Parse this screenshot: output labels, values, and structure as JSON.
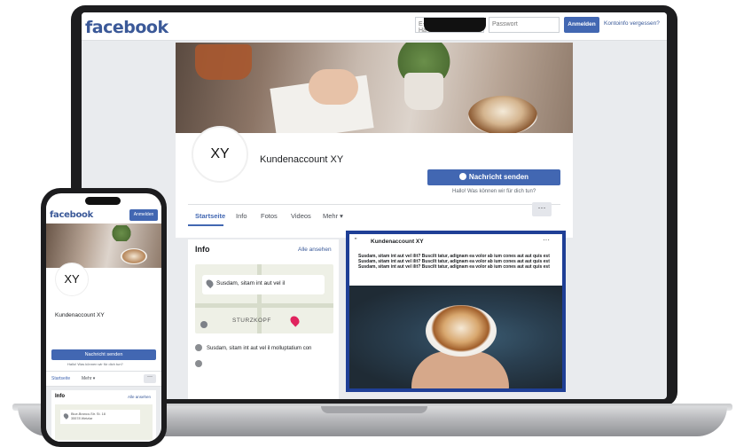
{
  "desktop": {
    "logo": "facebook",
    "login": {
      "email_placeholder": "E-Mail-Adresse oder Ha",
      "password_placeholder": "Passwort",
      "button_label": "Anmelden",
      "forgot_label": "Kontoinfo vergessen?"
    },
    "profile": {
      "avatar_text": "XY",
      "page_name": "Kundenaccount XY",
      "message_button": "Nachricht senden",
      "message_hint": "Hallo! Was können wir für dich tun?"
    },
    "tabs": [
      "Startseite",
      "Info",
      "Fotos",
      "Videos",
      "Mehr ▾"
    ],
    "more_button": "···",
    "info": {
      "title": "Info",
      "see_all": "Alle ansehen",
      "map_address": "Susdam, sitam int aut vel il",
      "map_label": "STURZKOPF",
      "row1": "Susdam, sitam int aut vel il molluptatium con",
      "row2": ""
    },
    "post": {
      "quote_icon": "\"",
      "author": "Kundenaccount XY",
      "menu": "···",
      "text": "Susdam, sitam int aut vel ilit? Buscilt tatur, adignam ea volor ab ium cones aut aut quis est Susdam, sitam int aut vel ilit? Buscilt tatur, adignam ea volor ab ium cones aut aut quis est Susdam, sitam int aut vel ilit? Buscilt tatur, adignam ea volor ab ium cones aut aut quis est"
    }
  },
  "mobile": {
    "logo": "facebook",
    "login_button": "Anmelden",
    "avatar_text": "XY",
    "page_name": "Kundenaccount XY",
    "message_button": "Nachricht senden",
    "message_hint": "Hallo! Was können wir für dich tun?",
    "tabs": [
      "Startseite",
      "Mehr ▾"
    ],
    "more_button": "···",
    "info_title": "Info",
    "info_see_all": "Alle ansehen",
    "map_address_line1": "Blue-Branco-Str. St. 18",
    "map_address_line2": "35578 Wetzlar"
  },
  "colors": {
    "brand_blue": "#4267b2",
    "logo_blue": "#3b5998",
    "post_frame": "#1f3f96"
  }
}
